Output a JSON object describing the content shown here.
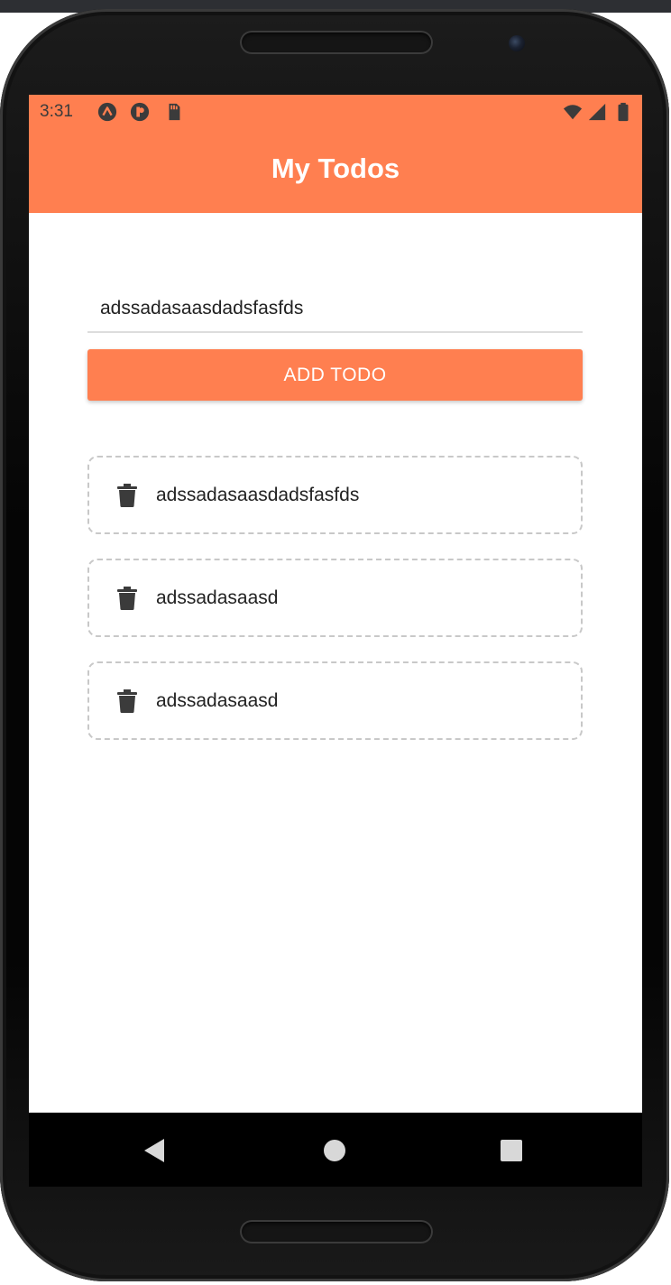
{
  "status_bar": {
    "time": "3:31",
    "icons": [
      "expo-icon",
      "app-notification-icon",
      "sd-card-icon",
      "wifi-icon",
      "signal-icon",
      "battery-icon"
    ]
  },
  "app_bar": {
    "title": "My Todos",
    "background_color": "#ff7f50"
  },
  "form": {
    "input_value": "adssadasaasdadsfasfds",
    "button_label": "ADD TODO"
  },
  "todos": [
    {
      "text": "adssadasaasdadsfasfds",
      "icon": "trash-icon"
    },
    {
      "text": "adssadasaasd",
      "icon": "trash-icon"
    },
    {
      "text": "adssadasaasd",
      "icon": "trash-icon"
    }
  ],
  "navigation": {
    "buttons": [
      "back-icon",
      "home-icon",
      "recents-icon"
    ]
  },
  "colors": {
    "accent": "#ff7f50",
    "text": "#222222",
    "icon": "#3b3b3b"
  }
}
